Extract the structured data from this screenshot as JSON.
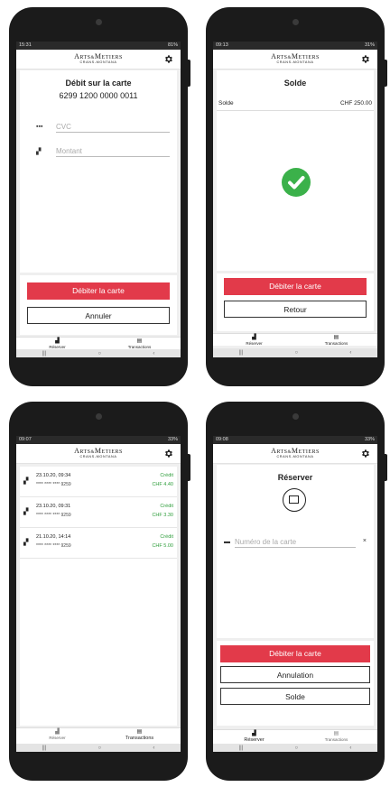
{
  "colors": {
    "accent": "#e23a4a",
    "success": "#3bb14a",
    "credit": "#2d9d3a"
  },
  "logo": {
    "main": "ArtsMetiers",
    "sub": "CRANS-MONTANA"
  },
  "nav": {
    "reserve": "Réserver",
    "transactions": "Transactions"
  },
  "screen1": {
    "status_time": "15:31",
    "status_right": "81%",
    "title": "Débit sur la carte",
    "card_number": "6299 1200 0000 0011",
    "cvc_placeholder": "CVC",
    "amount_placeholder": "Montant",
    "primary": "Débiter la carte",
    "secondary": "Annuler"
  },
  "screen2": {
    "status_time": "09:13",
    "status_right": "31%",
    "title": "Solde",
    "balance_label": "Solde",
    "balance_value": "CHF 250.00",
    "primary": "Débiter la carte",
    "secondary": "Retour"
  },
  "screen3": {
    "status_time": "09:07",
    "status_right": "33%",
    "transactions": [
      {
        "date": "23.10.20, 09:34",
        "number": "**** **** **** 9259",
        "type": "Crédit",
        "amount": "CHF 4.40"
      },
      {
        "date": "23.10.20, 09:31",
        "number": "**** **** **** 9259",
        "type": "Crédit",
        "amount": "CHF 3.30"
      },
      {
        "date": "21.10.20, 14:14",
        "number": "**** **** **** 9259",
        "type": "Crédit",
        "amount": "CHF 5.00"
      }
    ]
  },
  "screen4": {
    "status_time": "09:08",
    "status_right": "33%",
    "title": "Réserver",
    "card_placeholder": "Numéro de la carte",
    "clear": "×",
    "primary": "Débiter la carte",
    "secondary": "Annulation",
    "tertiary": "Solde"
  },
  "icons": [
    "gear-icon",
    "keypad-icon",
    "coins-icon",
    "check-icon",
    "qr-scan-icon",
    "card-icon",
    "close-icon",
    "back-icon",
    "home-icon",
    "recents-icon"
  ]
}
